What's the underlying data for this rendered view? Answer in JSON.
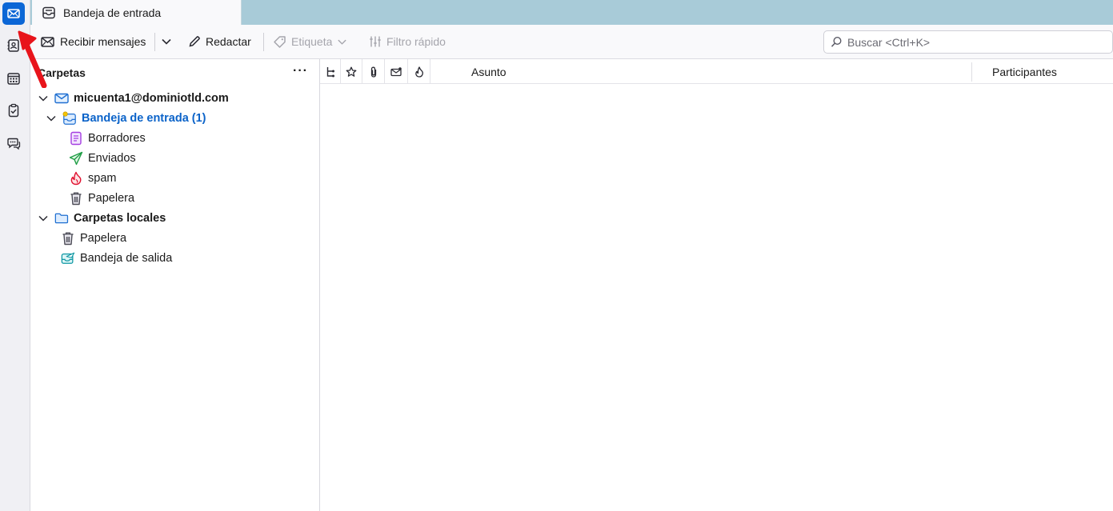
{
  "tab": {
    "label": "Bandeja de entrada"
  },
  "toolbar": {
    "get_messages": "Recibir mensajes",
    "write": "Redactar",
    "tag": "Etiqueta",
    "quick_filter": "Filtro rápido",
    "search_placeholder": "Buscar <Ctrl+K>"
  },
  "folder_pane": {
    "title": "Carpetas",
    "more": "···",
    "account": "micuenta1@dominiotld.com",
    "inbox": "Bandeja de entrada (1)",
    "subfolders": [
      "Borradores",
      "Enviados",
      "spam",
      "Papelera"
    ],
    "local_folders": "Carpetas locales",
    "local_subfolders": [
      "Papelera",
      "Bandeja de salida"
    ]
  },
  "thread_pane": {
    "subject_col": "Asunto",
    "participants_col": "Participantes"
  },
  "colors": {
    "accent": "#0b66d6",
    "tabstrip": "#a8cbd8",
    "annotation": "#e8141b"
  }
}
